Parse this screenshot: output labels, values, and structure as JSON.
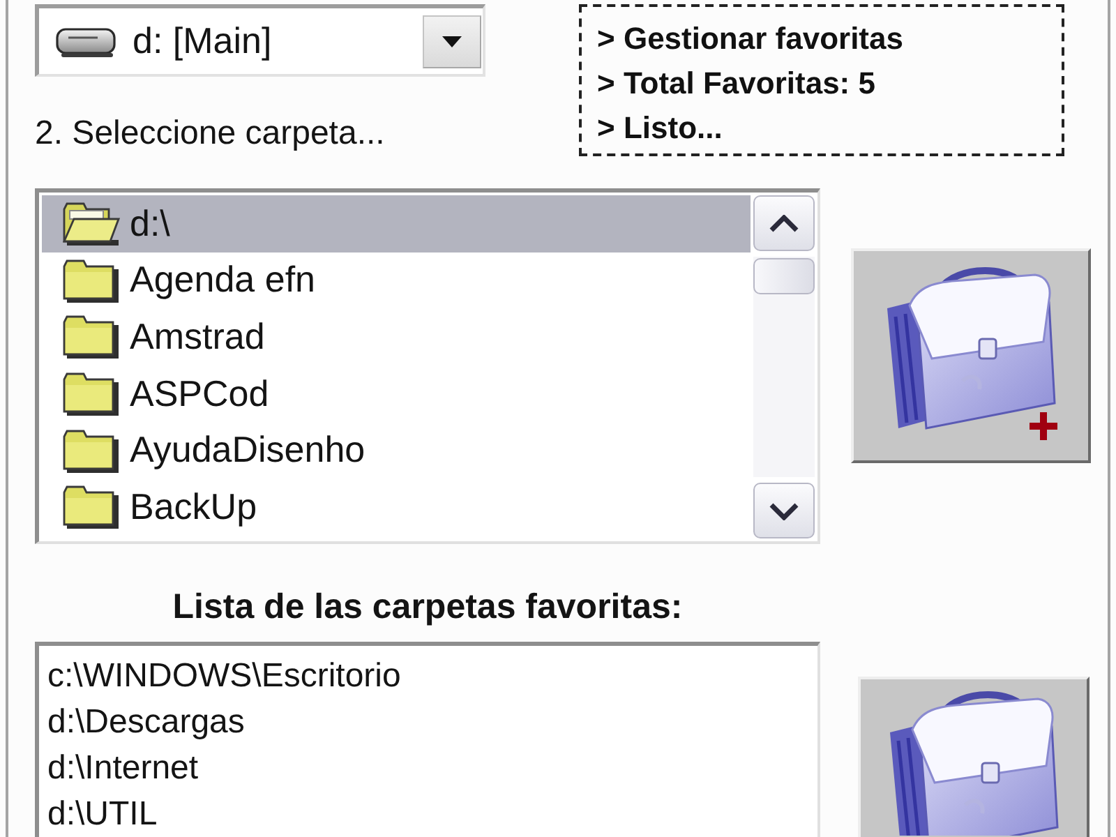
{
  "drive_select": {
    "value": "d: [Main]"
  },
  "folder_prompt": "2. Seleccione carpeta...",
  "status_box": {
    "lines": [
      "> Gestionar favoritas",
      "> Total Favoritas: 5",
      "> Listo..."
    ]
  },
  "folder_list": {
    "items": [
      {
        "label": "d:\\",
        "kind": "open",
        "selected": true
      },
      {
        "label": "Agenda efn",
        "kind": "closed",
        "selected": false
      },
      {
        "label": "Amstrad",
        "kind": "closed",
        "selected": false
      },
      {
        "label": "ASPCod",
        "kind": "closed",
        "selected": false
      },
      {
        "label": "AyudaDisenho",
        "kind": "closed",
        "selected": false
      },
      {
        "label": "BackUp",
        "kind": "closed",
        "selected": false
      }
    ]
  },
  "favorites": {
    "title": "Lista de las carpetas favoritas:",
    "items": [
      "c:\\WINDOWS\\Escritorio",
      "d:\\Descargas",
      "d:\\Internet",
      "d:\\UTIL"
    ]
  }
}
